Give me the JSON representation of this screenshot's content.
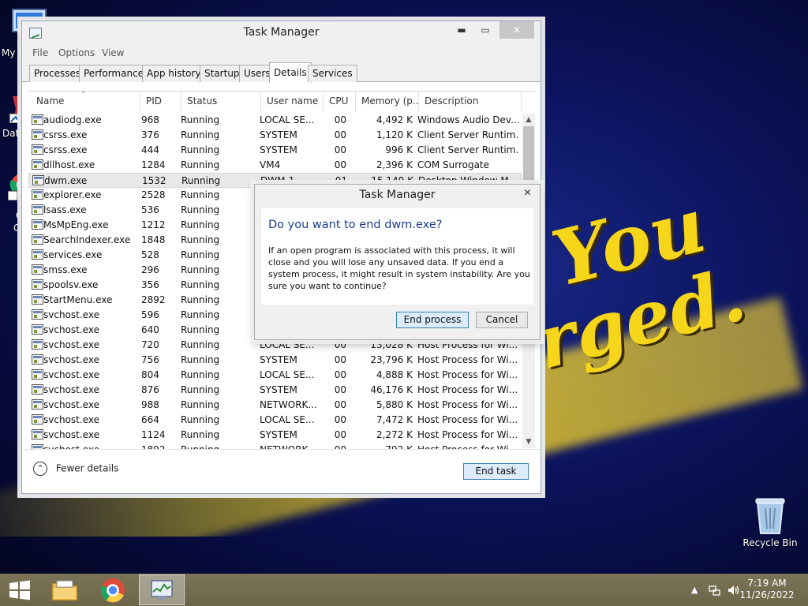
{
  "desktop": {
    "wallpaper_words": [
      "You",
      "rged."
    ],
    "left_labels": [
      "My C",
      "Data",
      "G",
      "C"
    ],
    "recycle_bin_label": "Recycle Bin"
  },
  "task_manager": {
    "title": "Task Manager",
    "window_controls": {
      "minimize": "▬",
      "maximize": "▭",
      "close": "✕"
    },
    "menu": [
      "File",
      "Options",
      "View"
    ],
    "tabs": [
      "Processes",
      "Performance",
      "App history",
      "Startup",
      "Users",
      "Details",
      "Services"
    ],
    "active_tab": "Details",
    "columns": [
      "Name",
      "PID",
      "Status",
      "User name",
      "CPU",
      "Memory (p...",
      "Description"
    ],
    "processes": [
      {
        "name": "audiodg.exe",
        "pid": "968",
        "status": "Running",
        "user": "LOCAL SE...",
        "cpu": "00",
        "memory": "4,492 K",
        "description": "Windows Audio Dev..."
      },
      {
        "name": "csrss.exe",
        "pid": "376",
        "status": "Running",
        "user": "SYSTEM",
        "cpu": "00",
        "memory": "1,120 K",
        "description": "Client Server Runtim..."
      },
      {
        "name": "csrss.exe",
        "pid": "444",
        "status": "Running",
        "user": "SYSTEM",
        "cpu": "00",
        "memory": "996 K",
        "description": "Client Server Runtim..."
      },
      {
        "name": "dllhost.exe",
        "pid": "1284",
        "status": "Running",
        "user": "VM4",
        "cpu": "00",
        "memory": "2,396 K",
        "description": "COM Surrogate"
      },
      {
        "name": "dwm.exe",
        "pid": "1532",
        "status": "Running",
        "user": "DWM-1",
        "cpu": "01",
        "memory": "15,140 K",
        "description": "Desktop Window M..."
      },
      {
        "name": "explorer.exe",
        "pid": "2528",
        "status": "Running",
        "user": "",
        "cpu": "",
        "memory": "",
        "description": ""
      },
      {
        "name": "lsass.exe",
        "pid": "536",
        "status": "Running",
        "user": "",
        "cpu": "",
        "memory": "",
        "description": ""
      },
      {
        "name": "MsMpEng.exe",
        "pid": "1212",
        "status": "Running",
        "user": "",
        "cpu": "",
        "memory": "",
        "description": ""
      },
      {
        "name": "SearchIndexer.exe",
        "pid": "1848",
        "status": "Running",
        "user": "",
        "cpu": "",
        "memory": "",
        "description": ""
      },
      {
        "name": "services.exe",
        "pid": "528",
        "status": "Running",
        "user": "",
        "cpu": "",
        "memory": "",
        "description": ""
      },
      {
        "name": "smss.exe",
        "pid": "296",
        "status": "Running",
        "user": "",
        "cpu": "",
        "memory": "",
        "description": ""
      },
      {
        "name": "spoolsv.exe",
        "pid": "356",
        "status": "Running",
        "user": "",
        "cpu": "",
        "memory": "",
        "description": ""
      },
      {
        "name": "StartMenu.exe",
        "pid": "2892",
        "status": "Running",
        "user": "",
        "cpu": "",
        "memory": "",
        "description": ""
      },
      {
        "name": "svchost.exe",
        "pid": "596",
        "status": "Running",
        "user": "",
        "cpu": "",
        "memory": "",
        "description": ""
      },
      {
        "name": "svchost.exe",
        "pid": "640",
        "status": "Running",
        "user": "",
        "cpu": "",
        "memory": "",
        "description": ""
      },
      {
        "name": "svchost.exe",
        "pid": "720",
        "status": "Running",
        "user": "LOCAL SE...",
        "cpu": "00",
        "memory": "13,028 K",
        "description": "Host Process for Wi..."
      },
      {
        "name": "svchost.exe",
        "pid": "756",
        "status": "Running",
        "user": "SYSTEM",
        "cpu": "00",
        "memory": "23,796 K",
        "description": "Host Process for Wi..."
      },
      {
        "name": "svchost.exe",
        "pid": "804",
        "status": "Running",
        "user": "LOCAL SE...",
        "cpu": "00",
        "memory": "4,888 K",
        "description": "Host Process for Wi..."
      },
      {
        "name": "svchost.exe",
        "pid": "876",
        "status": "Running",
        "user": "SYSTEM",
        "cpu": "00",
        "memory": "46,176 K",
        "description": "Host Process for Wi..."
      },
      {
        "name": "svchost.exe",
        "pid": "988",
        "status": "Running",
        "user": "NETWORK...",
        "cpu": "00",
        "memory": "5,880 K",
        "description": "Host Process for Wi..."
      },
      {
        "name": "svchost.exe",
        "pid": "664",
        "status": "Running",
        "user": "LOCAL SE...",
        "cpu": "00",
        "memory": "7,472 K",
        "description": "Host Process for Wi..."
      },
      {
        "name": "svchost.exe",
        "pid": "1124",
        "status": "Running",
        "user": "SYSTEM",
        "cpu": "00",
        "memory": "2,272 K",
        "description": "Host Process for Wi..."
      },
      {
        "name": "svchost.exe",
        "pid": "1892",
        "status": "Running",
        "user": "NETWORK...",
        "cpu": "00",
        "memory": "792 K",
        "description": "Host Process for Wi..."
      }
    ],
    "footer": {
      "fewer_details": "Fewer details",
      "end_task": "End task",
      "collapse_glyph": "⌃"
    }
  },
  "dialog": {
    "title": "Task Manager",
    "close_glyph": "✕",
    "question": "Do you want to end dwm.exe?",
    "message": "If an open program is associated with this process, it will close and you will lose any unsaved data. If you end a system process, it might result in system instability. Are you sure you want to continue?",
    "end_process": "End process",
    "cancel": "Cancel"
  },
  "taskbar": {
    "tray_arrow": "▲",
    "time": "7:19 AM",
    "date": "11/26/2022",
    "items": [
      "start-button",
      "file-explorer",
      "chrome",
      "task-manager"
    ]
  },
  "colors": {
    "accent_blue": "#1a3e8a",
    "taskbar": "#746d50",
    "wallpaper_yellow": "#f6d61a"
  }
}
